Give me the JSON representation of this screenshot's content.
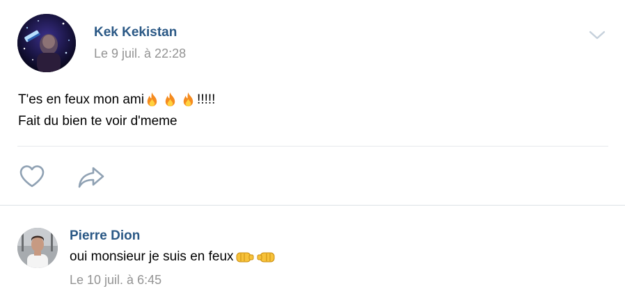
{
  "post": {
    "author": "Kek Kekistan",
    "date": "Le 9 juil. à 22:28",
    "text_line1": "T'es en feux mon ami",
    "text_line1_suffix": "!!!!!",
    "text_line2": "Fait du bien te voir d'meme",
    "emoji_icons": [
      "fire-icon",
      "fire-icon",
      "fire-icon"
    ],
    "actions": [
      "heart-icon",
      "share-arrow-icon"
    ],
    "menu_icon": "chevron-down-icon"
  },
  "comment": {
    "author": "Pierre Dion",
    "text": "oui monsieur je suis en feux",
    "emoji_icons": [
      "left-fist-icon",
      "right-fist-icon"
    ],
    "date": "Le 10 juil. à 6:45"
  },
  "colors": {
    "link": "#2a5885",
    "meta": "#939393",
    "icon": "#8fa1b3",
    "divider": "#e7e8ec"
  }
}
